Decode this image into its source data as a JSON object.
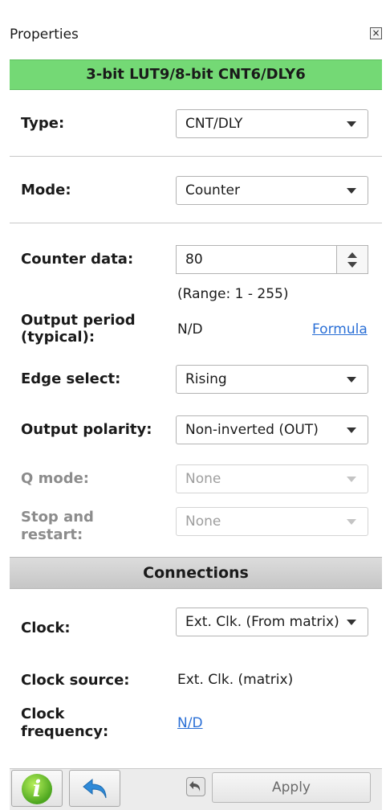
{
  "panel": {
    "title": "Properties",
    "close_glyph": "×",
    "block_name": "3-bit LUT9/8-bit CNT6/DLY6"
  },
  "fields": {
    "type": {
      "label": "Type:",
      "value": "CNT/DLY"
    },
    "mode": {
      "label": "Mode:",
      "value": "Counter"
    },
    "counter_data": {
      "label": "Counter data:",
      "value": "80",
      "range": "(Range:  1 - 255)"
    },
    "output_period": {
      "label_line1": "Output period",
      "label_line2": "(typical):",
      "value": "N/D",
      "link": "Formula"
    },
    "edge_select": {
      "label": "Edge select:",
      "value": "Rising"
    },
    "output_polarity": {
      "label": "Output polarity:",
      "value": "Non-inverted (OUT)"
    },
    "q_mode": {
      "label": "Q mode:",
      "value": "None",
      "disabled": true
    },
    "stop_restart": {
      "label_line1": "Stop and",
      "label_line2": "restart:",
      "value": "None",
      "disabled": true
    }
  },
  "connections": {
    "header": "Connections",
    "clock": {
      "label": "Clock:",
      "value": "Ext. Clk. (From matrix)"
    },
    "clock_source": {
      "label": "Clock source:",
      "value": "Ext. Clk. (matrix)"
    },
    "clock_frequency": {
      "label_line1": "Clock",
      "label_line2": "frequency:",
      "value": "N/D"
    }
  },
  "footer": {
    "info_icon": "info-icon",
    "info_glyph": "i",
    "undo_icon": "undo-arrow-icon",
    "apply_label": "Apply"
  },
  "colors": {
    "header_green": "#74d975",
    "link_blue": "#2a6fd6",
    "connections_gray": "#cfcfcf"
  }
}
